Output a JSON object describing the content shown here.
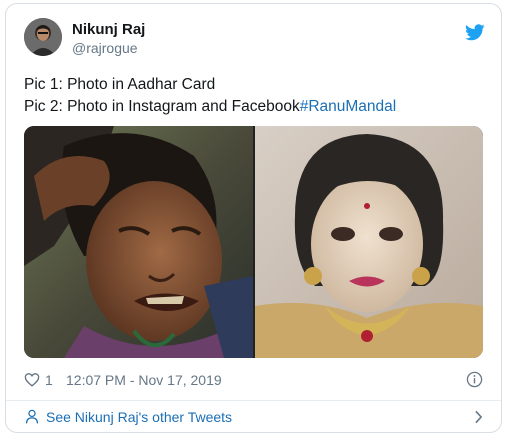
{
  "author": {
    "display_name": "Nikunj Raj",
    "handle": "@rajrogue"
  },
  "tweet": {
    "line1": "Pic 1: Photo in Aadhar Card",
    "line2_text": "Pic 2: Photo in Instagram and Facebook",
    "hashtag": "#RanuMandal"
  },
  "media": {
    "images": [
      {
        "icon": "photo-woman-crying"
      },
      {
        "icon": "photo-woman-bridal-makeup"
      }
    ]
  },
  "meta": {
    "like_count": "1",
    "timestamp": "12:07 PM - Nov 17, 2019"
  },
  "footer": {
    "see_more_label": "See Nikunj Raj's other Tweets"
  },
  "colors": {
    "link": "#1b6fb5",
    "twitter_blue": "#1da1f2",
    "muted": "#657786",
    "border": "#d8dee3"
  }
}
